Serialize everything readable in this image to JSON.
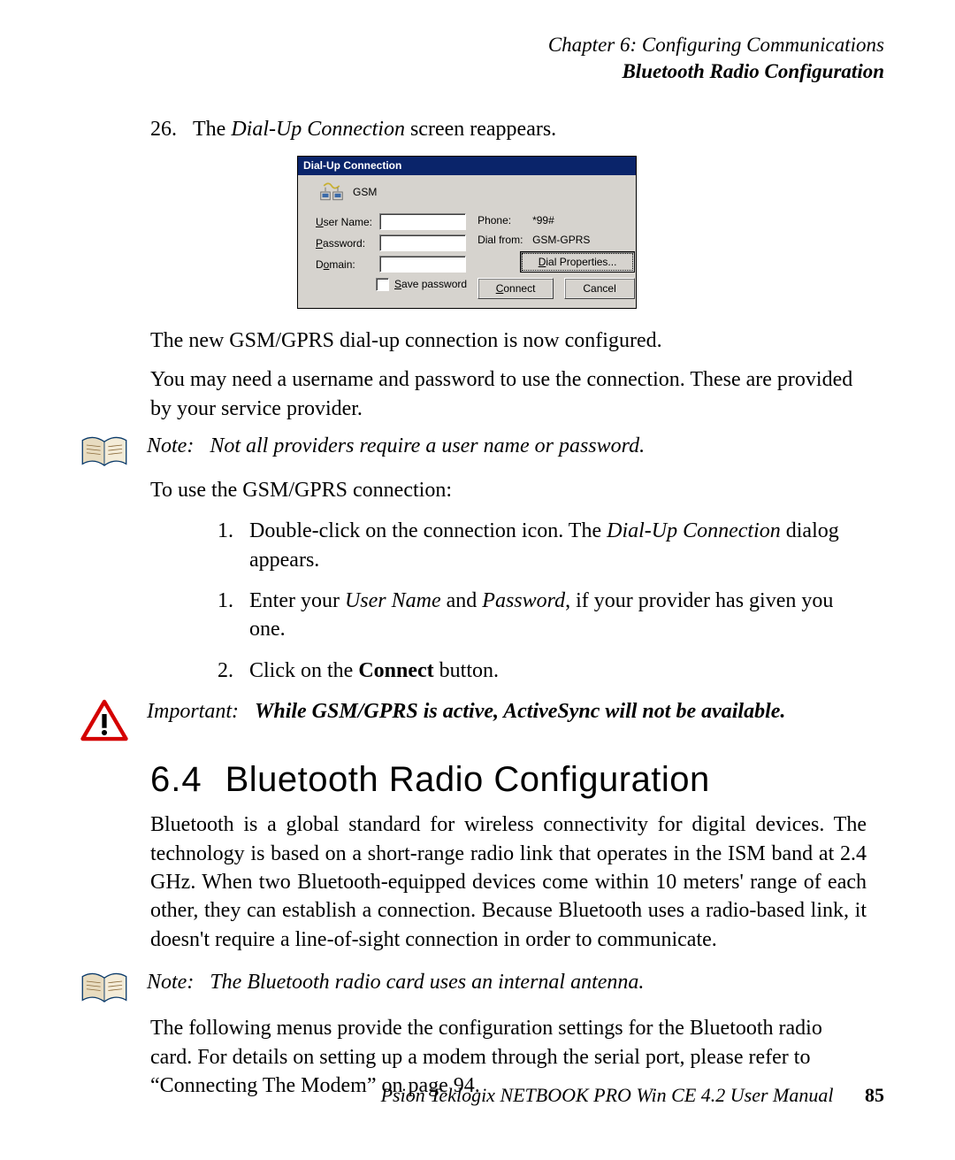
{
  "header": {
    "chapter": "Chapter 6:  Configuring Communications",
    "section": "Bluetooth Radio Configuration"
  },
  "step26": {
    "num": "26.",
    "text_a": "The ",
    "text_em": "Dial-Up Connection",
    "text_b": " screen reappears."
  },
  "dialog": {
    "title": "Dial-Up Connection",
    "conn_name": "GSM",
    "labels": {
      "user": "User Name:",
      "pass": "Password:",
      "domain": "Domain:",
      "save": "Save password",
      "phone": "Phone:",
      "dialfrom": "Dial from:"
    },
    "values": {
      "phone": "*99#",
      "dialfrom": "GSM-GPRS"
    },
    "buttons": {
      "dialprops": "Dial Properties...",
      "connect": "Connect",
      "cancel": "Cancel"
    }
  },
  "p1": "The new GSM/GPRS dial-up connection is now configured.",
  "p2": "You may need a username and password to use the connection. These are provided by your service provider.",
  "note1": {
    "label": "Note:",
    "text": "Not all providers require a user name or password."
  },
  "p3": "To use the GSM/GPRS connection:",
  "steps": {
    "s1": {
      "num": "1.",
      "a": "Double-click on the connection icon. The ",
      "em": "Dial-Up Connection",
      "b": " dialog appears."
    },
    "s2": {
      "num": "1.",
      "a": "Enter your ",
      "em1": "User Name",
      "mid": " and ",
      "em2": "Password",
      "b": ", if your provider has given you one."
    },
    "s3": {
      "num": "2.",
      "a": "Click on the ",
      "strong": "Connect",
      "b": " button."
    }
  },
  "important": {
    "label": "Important:",
    "text": "While GSM/GPRS is active, ActiveSync will not be available."
  },
  "section64": {
    "num": "6.4",
    "title": "Bluetooth Radio Configuration"
  },
  "p4": "Bluetooth is a global standard for wireless connectivity for digital devices. The technology is based on a short-range radio link that operates in the ISM band at 2.4 GHz. When two Bluetooth-equipped devices come within 10 meters' range of each other, they can establish a connection. Because Bluetooth uses a radio-based link, it doesn't require a line-of-sight connection in order to communicate.",
  "note2": {
    "label": "Note:",
    "text": "The Bluetooth radio card uses an internal antenna."
  },
  "p5": "The following menus provide the configuration settings for the Bluetooth radio card. For details on setting up a modem through the serial port, please refer to “Connecting The Modem” on page 94.",
  "footer": {
    "text": "Psion Teklogix NETBOOK PRO Win CE 4.2 User Manual",
    "page": "85"
  }
}
